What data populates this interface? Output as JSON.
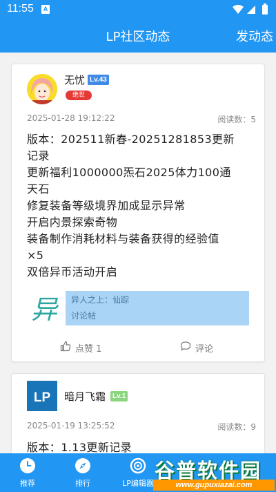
{
  "status_bar": {
    "time": "11:55",
    "notification_icon": "A"
  },
  "header": {
    "title": "LP社区动态",
    "post_button": "发动态"
  },
  "posts": [
    {
      "username": "无忧",
      "level": "Lv.43",
      "title_tag": "绝世",
      "date": "2025-01-28 19:12:22",
      "read_count": "阅读数：5",
      "body_lines": [
        "版本：202511新春-20251281853更新",
        "记录",
        "更新福利1000000炁石2025体力100通",
        "天石",
        "修复装备等级境界加成显示异常",
        "开启内景探索奇物",
        "装备制作消耗材料与装备获得的经验值",
        "×5",
        "双倍异币活动开启"
      ],
      "topic": {
        "icon_char": "异",
        "name": "异人之上：仙踪",
        "type": "讨论帖"
      },
      "like_label": "点赞 1",
      "comment_label": "评论"
    },
    {
      "username": "暗月飞霜",
      "level": "Lv.1",
      "avatar_text": "LP",
      "date": "2025-01-19 13:25:52",
      "read_count": "阅读数：9",
      "body_lines": [
        "版本：1.13更新记录"
      ]
    }
  ],
  "bottom_nav": [
    {
      "label": "推荐",
      "icon": "clock-icon"
    },
    {
      "label": "排行",
      "icon": "compass-icon"
    },
    {
      "label": "LP编辑器",
      "icon": "target-icon"
    }
  ],
  "watermark": {
    "name": "谷普软件园",
    "url": "www.gupuxiazai.com"
  }
}
